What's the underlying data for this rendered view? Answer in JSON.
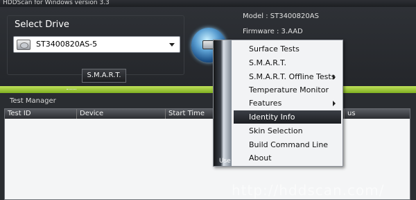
{
  "window": {
    "title": "HDDScan for Windows version 3.3"
  },
  "drive_panel": {
    "title": "Select Drive",
    "selected_drive": "ST3400820AS-5",
    "smart_button_label": "S.M.A.R.T."
  },
  "drive_info": {
    "model": "Model : ST3400820AS",
    "firmware": "Firmware : 3.AAD"
  },
  "test_manager": {
    "title": "Test Manager",
    "columns": [
      "Test ID",
      "Device",
      "Start Time",
      "",
      "",
      "us"
    ]
  },
  "context_menu": {
    "gutter_text": "Use",
    "highlighted_item": "Identity Info",
    "items": [
      {
        "label": "Surface Tests",
        "has_submenu": false
      },
      {
        "label": "S.M.A.R.T.",
        "has_submenu": false
      },
      {
        "label": "S.M.A.R.T. Offline Tests",
        "has_submenu": true
      },
      {
        "label": "Temperature Monitor",
        "has_submenu": false
      },
      {
        "label": "Features",
        "has_submenu": true
      },
      {
        "label": "Identity Info",
        "has_submenu": false
      },
      {
        "label": "Skin Selection",
        "has_submenu": false
      },
      {
        "label": "Build Command Line",
        "has_submenu": false
      },
      {
        "label": "About",
        "has_submenu": false
      }
    ]
  },
  "watermark": "http://hddscan.com/",
  "colors": {
    "accent": "#9cc83a",
    "background": "#1f2125",
    "menu_highlight": "#2b2e33"
  }
}
